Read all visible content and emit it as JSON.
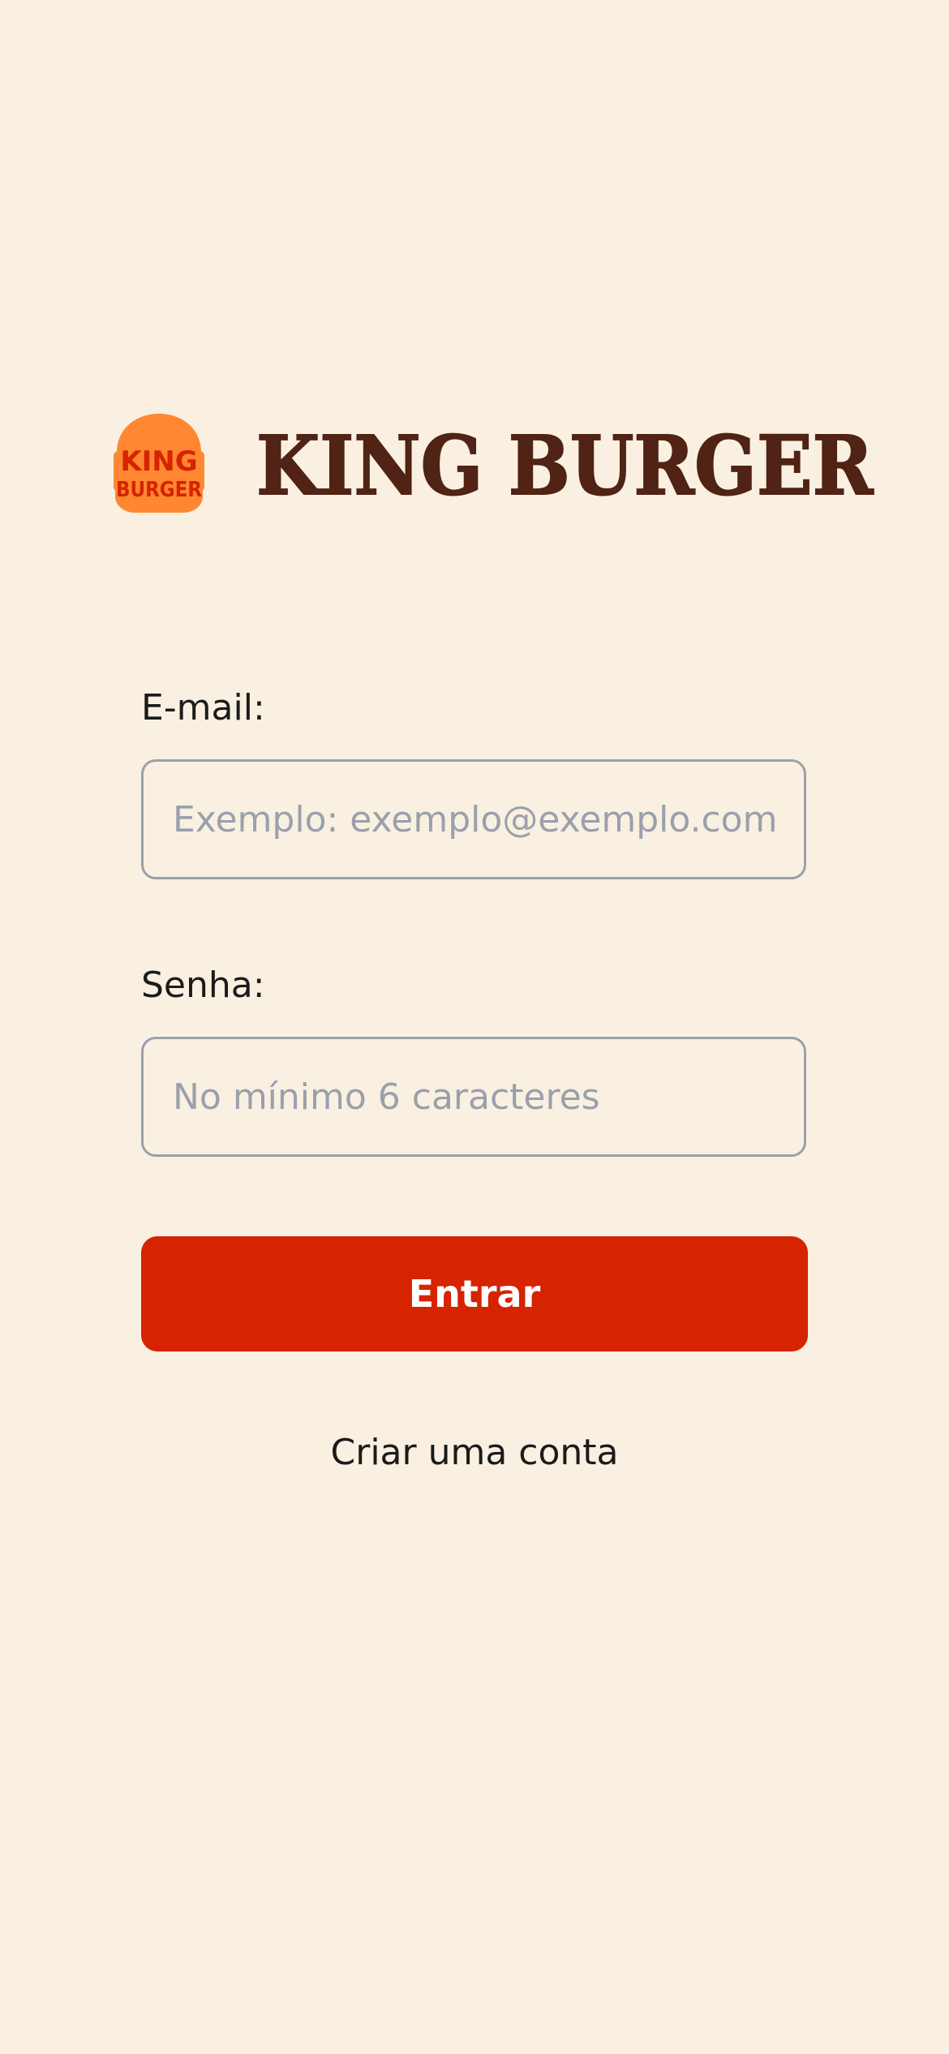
{
  "brand": {
    "logo_text_line1": "KING",
    "logo_text_line2": "BURGER",
    "name": "KING BURGER",
    "colors": {
      "name": "#502314",
      "logo_bun": "#ff8732",
      "logo_text": "#d62300"
    }
  },
  "form": {
    "email_label": "E-mail:",
    "email_placeholder": "Exemplo: exemplo@exemplo.com.br",
    "email_value": "",
    "password_label": "Senha:",
    "password_placeholder": "No mínimo 6 caracteres",
    "password_value": "",
    "submit_label": "Entrar",
    "create_account_label": "Criar uma conta"
  },
  "theme": {
    "background": "#f9f0e1",
    "accent": "#d62300",
    "input_border": "#9aa0ab",
    "text": "#1b1b1b"
  }
}
